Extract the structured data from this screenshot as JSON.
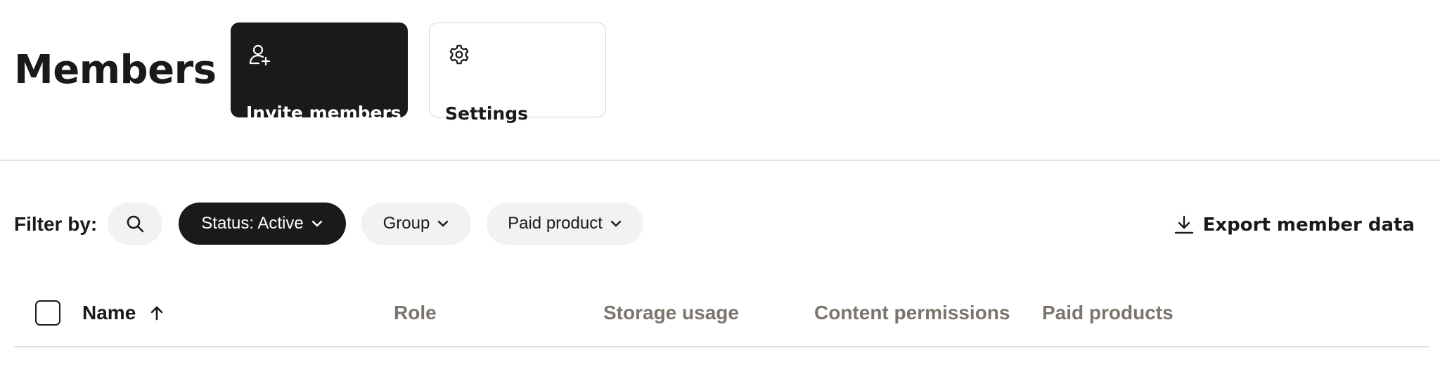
{
  "header": {
    "title": "Members",
    "actions": [
      {
        "label": "Invite members",
        "icon": "person-add-icon",
        "style": "primary"
      },
      {
        "label": "Settings",
        "icon": "gear-icon",
        "style": "secondary"
      }
    ]
  },
  "filters": {
    "label": "Filter by:",
    "search_icon": "search-icon",
    "pills": [
      {
        "label": "Status: Active",
        "active": true
      },
      {
        "label": "Group",
        "active": false
      },
      {
        "label": "Paid product",
        "active": false
      }
    ],
    "export_label": "Export member data"
  },
  "table": {
    "columns": [
      {
        "label": "Name",
        "sorted": "asc"
      },
      {
        "label": "Role"
      },
      {
        "label": "Storage usage"
      },
      {
        "label": "Content permissions"
      },
      {
        "label": "Paid products"
      }
    ]
  },
  "colors": {
    "primary": "#1b1a19",
    "pill_bg": "#f3f2f0",
    "muted_text": "#7b756d",
    "divider": "#e3e1de"
  }
}
